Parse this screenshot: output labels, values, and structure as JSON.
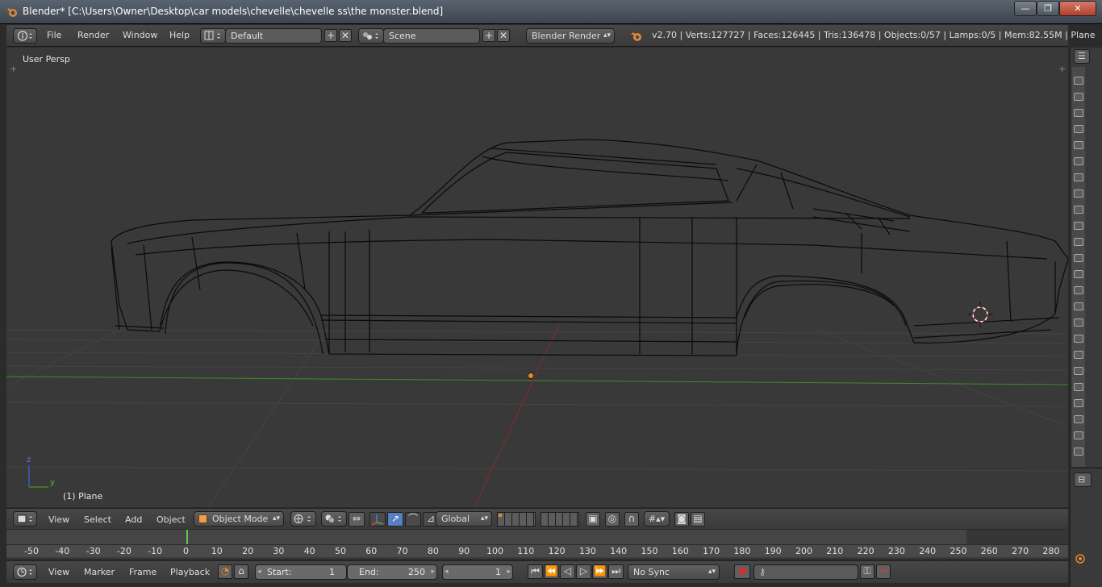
{
  "window": {
    "title": "Blender* [C:\\Users\\Owner\\Desktop\\car models\\chevelle\\chevelle ss\\the monster.blend]",
    "min_glyph": "—",
    "max_glyph": "❐",
    "close_glyph": "✕"
  },
  "info_header": {
    "menus": [
      "File",
      "Render",
      "Window",
      "Help"
    ],
    "layout": "Default",
    "scene": "Scene",
    "engine": "Blender Render",
    "stats": "v2.70 | Verts:127727 | Faces:126445 | Tris:136478 | Objects:0/57 | Lamps:0/5 | Mem:82.55M | Plane",
    "add_glyph": "+",
    "remove_glyph": "✕"
  },
  "viewport": {
    "view_name": "User Persp",
    "object_label": "(1) Plane",
    "axis_z": "z",
    "axis_y": "y",
    "plus_glyph": "+"
  },
  "view_header": {
    "menus": [
      "View",
      "Select",
      "Add",
      "Object"
    ],
    "mode": "Object Mode",
    "orientation": "Global"
  },
  "timeline": {
    "ticks": [
      "-50",
      "-40",
      "-30",
      "-20",
      "-10",
      "0",
      "10",
      "20",
      "30",
      "40",
      "50",
      "60",
      "70",
      "80",
      "90",
      "100",
      "110",
      "120",
      "130",
      "140",
      "150",
      "160",
      "170",
      "180",
      "190",
      "200",
      "210",
      "220",
      "230",
      "240",
      "250",
      "260",
      "270",
      "280"
    ],
    "current_frame_value": 1
  },
  "playback_header": {
    "menus": [
      "View",
      "Marker",
      "Frame",
      "Playback"
    ],
    "start_label": "Start:",
    "start_value": "1",
    "end_label": "End:",
    "end_value": "250",
    "current_frame": "1",
    "sync": "No Sync"
  },
  "icons": {
    "blender": "blender-logo-icon",
    "info": "info-editor-icon",
    "screen": "screen-layout-icon",
    "scene": "scene-icon",
    "render": "render-icon"
  },
  "colors": {
    "accent_orange": "#e8872c",
    "viewport_bg": "#393939",
    "wire": "#000000",
    "grid": "#4a4a4a",
    "y_axis": "#3d8c2a",
    "x_axis": "#8a2a2a",
    "selected_blue": "#5680c2"
  }
}
